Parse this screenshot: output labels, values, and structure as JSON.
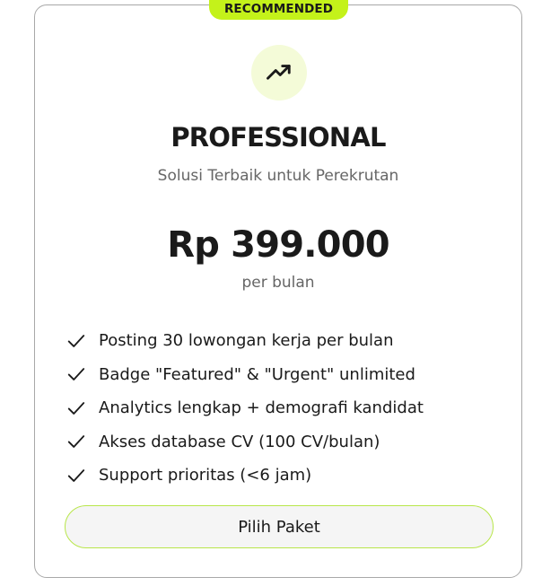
{
  "card": {
    "badge": "RECOMMENDED",
    "icon": "trending-up-icon",
    "plan_name": "PROFESSIONAL",
    "tagline": "Solusi Terbaik untuk Perekrutan",
    "price": "Rp 399.000",
    "period": "per bulan",
    "features": [
      {
        "icon": "check-icon",
        "label": "Posting 30 lowongan kerja per bulan"
      },
      {
        "icon": "check-icon",
        "label": "Badge \"Featured\" & \"Urgent\" unlimited"
      },
      {
        "icon": "check-icon",
        "label": "Analytics lengkap + demografi kandidat"
      },
      {
        "icon": "check-icon",
        "label": "Akses database CV (100 CV/bulan)"
      },
      {
        "icon": "check-icon",
        "label": "Support prioritas (<6 jam)"
      }
    ],
    "button_label": "Pilih Paket"
  },
  "colors": {
    "accent": "#c4f21a",
    "icon_bg": "#f4fbd8",
    "button_border": "#b8e64a",
    "button_bg": "#f5f5f5",
    "card_border": "#a8a8a8",
    "muted_text": "#666666",
    "text": "#1a1a1a"
  }
}
